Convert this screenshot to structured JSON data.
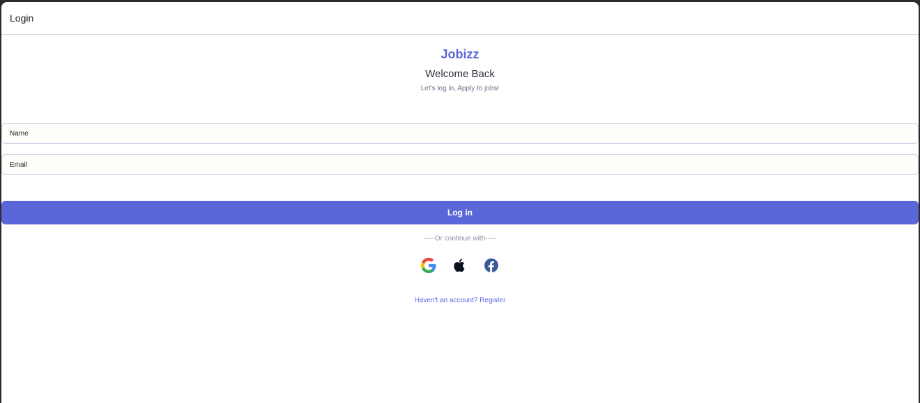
{
  "header": {
    "title": "Login"
  },
  "hero": {
    "brand": "Jobizz",
    "welcome": "Welcome Back",
    "tagline": "Let's log in, Apply to jobs!"
  },
  "form": {
    "name_placeholder": "Name",
    "email_placeholder": "Email",
    "submit_label": "Log in"
  },
  "alt_login": {
    "divider": "-----Or continue with-----",
    "providers": [
      {
        "name": "google",
        "icon": "google-icon"
      },
      {
        "name": "apple",
        "icon": "apple-icon"
      },
      {
        "name": "facebook",
        "icon": "facebook-icon"
      }
    ]
  },
  "footer": {
    "register_link": "Haven't an account? Register"
  },
  "colors": {
    "accent": "#5b67d8",
    "facebook": "#3b5998",
    "apple": "#0b1020"
  }
}
